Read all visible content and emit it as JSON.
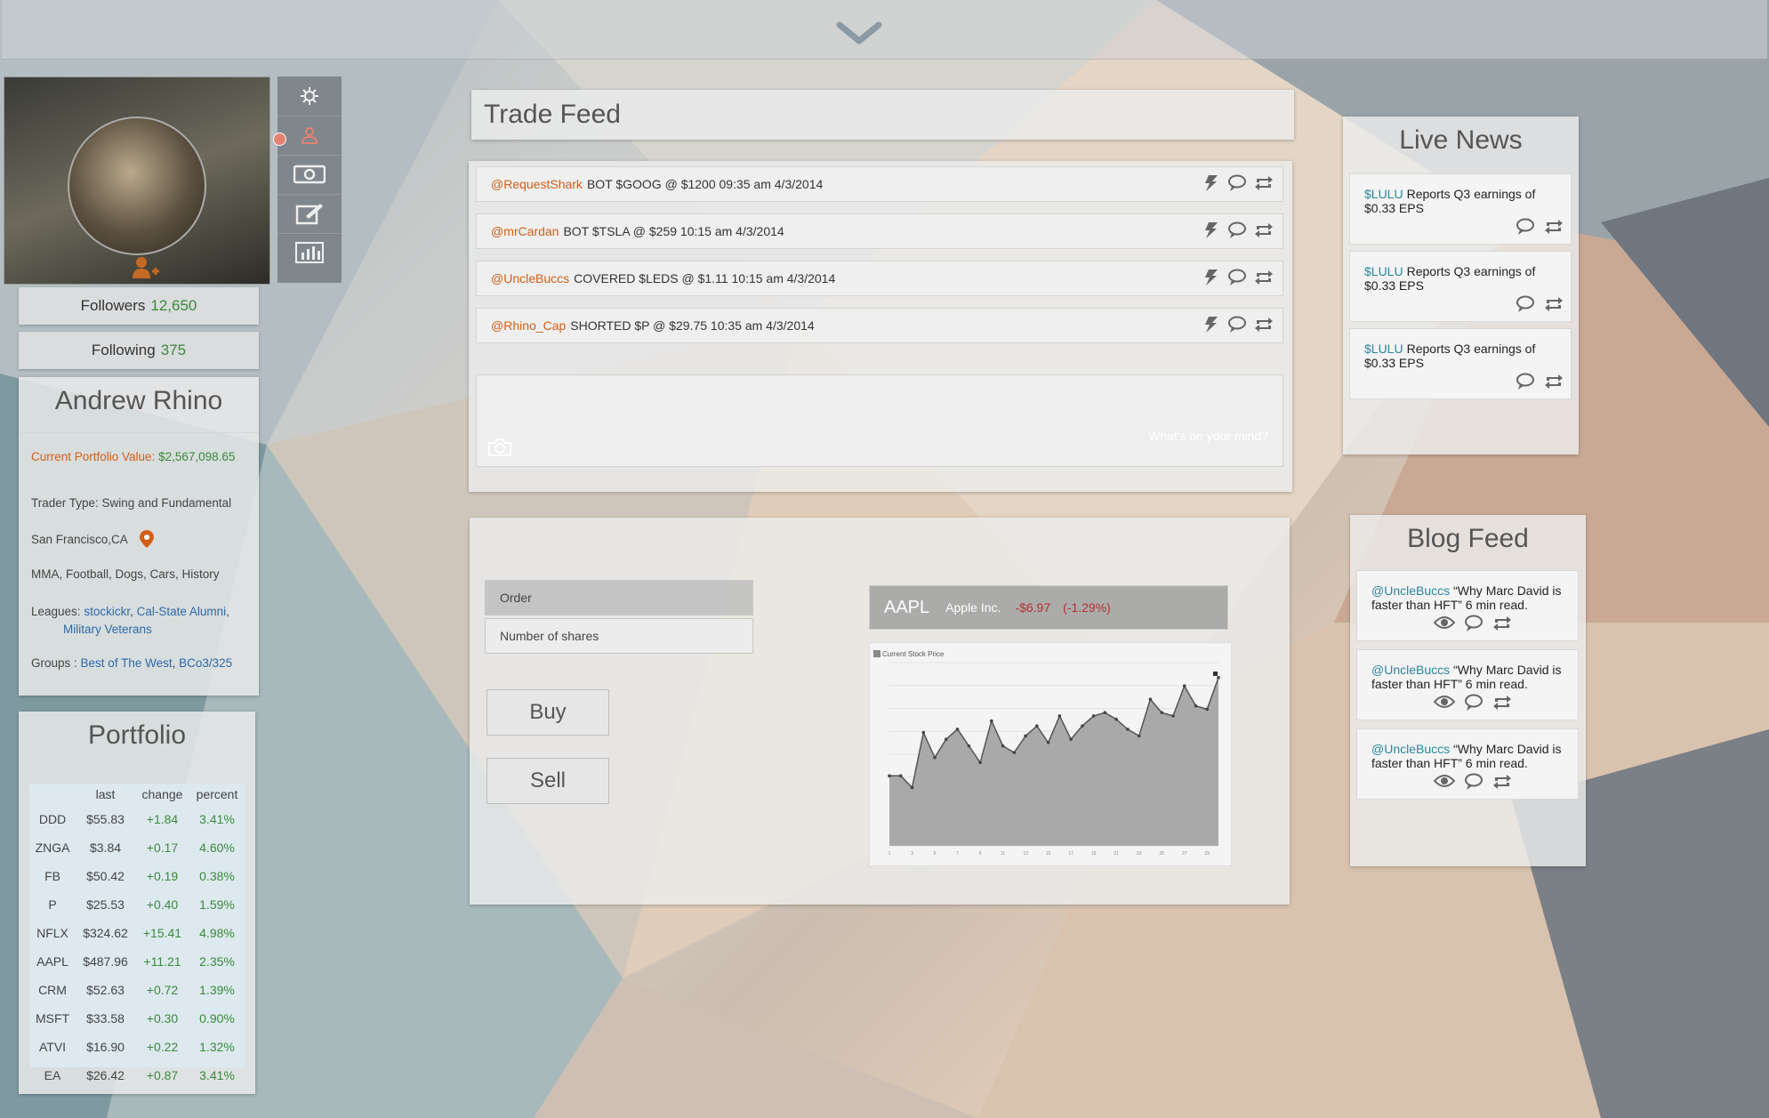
{
  "colors": {
    "accent_orange": "#d35f16",
    "gain_green": "#3a8a3a",
    "link_blue": "#2d6aa8",
    "loss_red": "#b83030"
  },
  "topbar": {
    "toggle_icon": "chevron-down-icon"
  },
  "profile": {
    "followers_label": "Followers",
    "followers_count": "12,650",
    "following_label": "Following",
    "following_count": "375",
    "name": "Andrew Rhino",
    "portfolio_value_label": "Current Portfolio Value:",
    "portfolio_value": "$2,567,098.65",
    "trader_type": "Trader Type: Swing and Fundamental",
    "location": "San Francisco,CA",
    "interests": "MMA, Football, Dogs, Cars, History",
    "leagues_label": "Leagues:",
    "leagues": [
      "stockickr",
      "Cal-State Alumni",
      "Military Veterans"
    ],
    "groups_label": "Groups :",
    "groups": [
      "Best of The West",
      "BCo3/325"
    ]
  },
  "sidebar_icons": [
    "gear-icon",
    "user-icon",
    "money-icon",
    "edit-icon",
    "bar-chart-icon"
  ],
  "portfolio": {
    "title": "Portfolio",
    "columns": [
      "",
      "last",
      "change",
      "percent"
    ],
    "rows": [
      [
        "DDD",
        "$55.83",
        "+1.84",
        "3.41%"
      ],
      [
        "ZNGA",
        "$3.84",
        "+0.17",
        "4.60%"
      ],
      [
        "FB",
        "$50.42",
        "+0.19",
        "0.38%"
      ],
      [
        "P",
        "$25.53",
        "+0.40",
        "1.59%"
      ],
      [
        "NFLX",
        "$324.62",
        "+15.41",
        "4.98%"
      ],
      [
        "AAPL",
        "$487.96",
        "+11.21",
        "2.35%"
      ],
      [
        "CRM",
        "$52.63",
        "+0.72",
        "1.39%"
      ],
      [
        "MSFT",
        "$33.58",
        "+0.30",
        "0.90%"
      ],
      [
        "ATVI",
        "$16.90",
        "+0.22",
        "1.32%"
      ],
      [
        "EA",
        "$26.42",
        "+0.87",
        "3.41%"
      ]
    ]
  },
  "trade_feed": {
    "title": "Trade Feed",
    "items": [
      {
        "user": "@RequestShark",
        "text": "BOT $GOOG @ $1200 09:35 am 4/3/2014"
      },
      {
        "user": "@mrCardan",
        "text": "BOT $TSLA @ $259 10:15 am 4/3/2014"
      },
      {
        "user": "@UncleBuccs",
        "text": "COVERED $LEDS @ $1.11 10:15 am 4/3/2014"
      },
      {
        "user": "@Rhino_Cap",
        "text": "SHORTED $P @ $29.75 10:35 am 4/3/2014"
      }
    ],
    "composer_placeholder": "What's on your mind?"
  },
  "order": {
    "order_placeholder": "Order",
    "shares_placeholder": "Number of shares",
    "buy_label": "Buy",
    "sell_label": "Sell"
  },
  "quote": {
    "symbol": "AAPL",
    "name": "Apple Inc.",
    "change": "-$6.97",
    "percent": "(-1.29%)"
  },
  "chart_data": {
    "type": "area",
    "title": "Current Stock Price",
    "legend": "",
    "legend_position": "top-right",
    "grid": true,
    "x": [
      1,
      2,
      3,
      4,
      5,
      6,
      7,
      8,
      9,
      10,
      11,
      12,
      13,
      14,
      15,
      16,
      17,
      18,
      19,
      20,
      21,
      22,
      23,
      24,
      25,
      26,
      27,
      28,
      29,
      30
    ],
    "y": [
      42,
      42,
      35,
      68,
      53,
      64,
      70,
      60,
      50,
      75,
      60,
      56,
      66,
      72,
      62,
      78,
      64,
      72,
      78,
      80,
      76,
      70,
      66,
      88,
      80,
      78,
      96,
      84,
      82,
      101
    ],
    "ylim": [
      0,
      110
    ]
  },
  "live_news": {
    "title": "Live News",
    "items": [
      {
        "ticker": "$LULU",
        "text": "Reports Q3 earnings of $0.33 EPS"
      },
      {
        "ticker": "$LULU",
        "text": "Reports Q3 earnings of $0.33 EPS"
      },
      {
        "ticker": "$LULU",
        "text": "Reports Q3 earnings of $0.33 EPS"
      }
    ]
  },
  "blog_feed": {
    "title": "Blog Feed",
    "items": [
      {
        "user": "@UncleBuccs",
        "text": "“Why Marc David is faster than HFT” 6 min read."
      },
      {
        "user": "@UncleBuccs",
        "text": "“Why Marc David is faster than HFT” 6 min read."
      },
      {
        "user": "@UncleBuccs",
        "text": "“Why Marc David is faster than HFT” 6 min read."
      }
    ]
  }
}
